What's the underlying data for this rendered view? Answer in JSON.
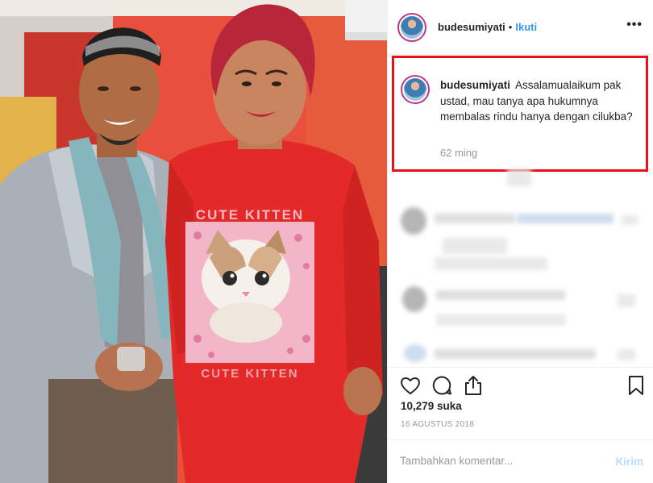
{
  "post": {
    "username": "budesumiyati",
    "separator": "•",
    "follow_label": "Ikuti",
    "more_icon": "ellipsis-icon",
    "more_label": "•••"
  },
  "photo": {
    "shirt_text_top": "CUTE KITTEN",
    "shirt_text_bottom": "CUTE KITTEN",
    "shirt_color": "#e42a28",
    "background_color": "#e9473a"
  },
  "highlighted_comment": {
    "username": "budesumiyati",
    "text": "Assalamualaikum pak ustad, mau tanya apa hukumnya membalas rindu hanya dengan cilukba?",
    "time": "62 ming",
    "highlight_color": "#e8111b"
  },
  "actions": {
    "like_icon": "heart-icon",
    "comment_icon": "speech-bubble-icon",
    "share_icon": "share-icon",
    "save_icon": "bookmark-icon"
  },
  "likes_text": "10,279 suka",
  "date_text": "16 AGUSTUS 2018",
  "add_comment": {
    "placeholder": "Tambahkan komentar...",
    "post_label": "Kirim"
  },
  "colors": {
    "link": "#3897f0",
    "post_disabled": "#b2dffc",
    "secondary_text": "#999999"
  }
}
